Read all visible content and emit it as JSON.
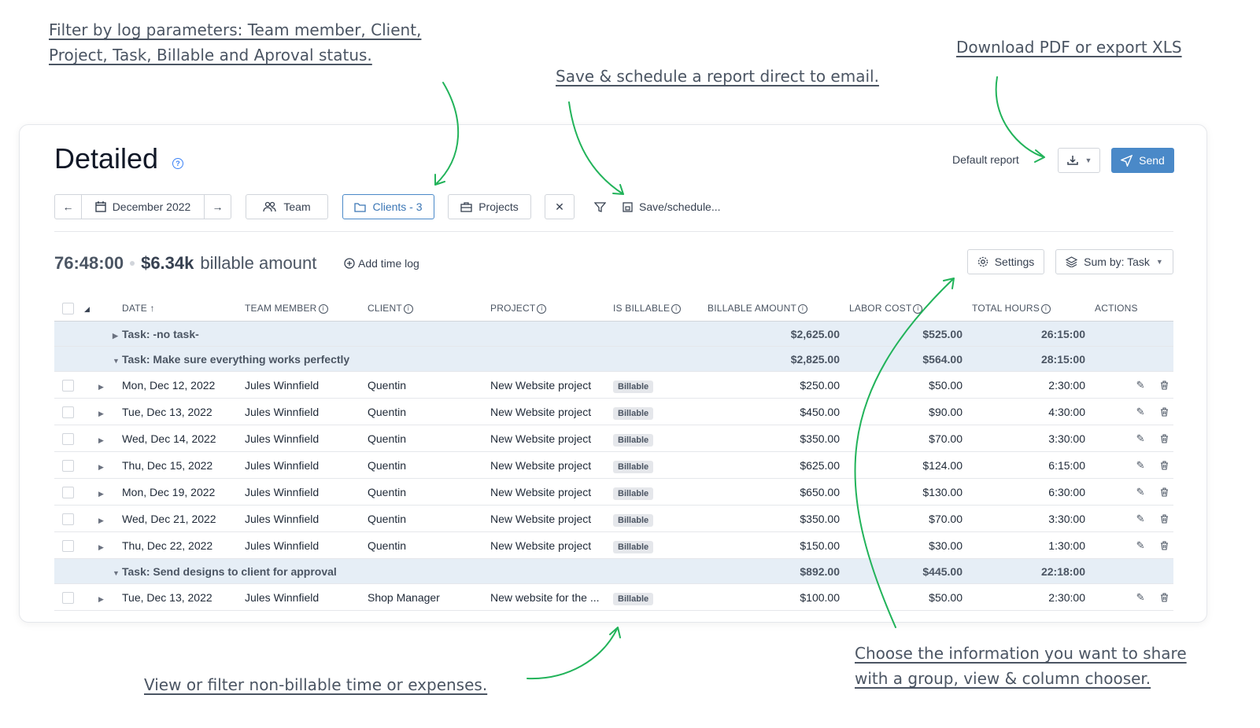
{
  "annotations": {
    "filter_line1": "Filter by log parameters: Team member, Client, ",
    "filter_line2": "Project, Task, Billable and Aproval status.",
    "save_schedule": "Save & schedule a report direct to email.",
    "download": "Download PDF or export XLS",
    "non_billable": "View or filter non-billable time or expenses.",
    "choose_line1": "Choose the information you want to share",
    "choose_line2": "with a group, view & column chooser."
  },
  "header": {
    "title": "Detailed",
    "default_report": "Default report",
    "send_label": "Send"
  },
  "filters": {
    "date_label": "December 2022",
    "team_label": "Team",
    "clients_label": "Clients - 3",
    "projects_label": "Projects",
    "clear_label": "✕",
    "save_label": "Save/schedule..."
  },
  "summary": {
    "hours": "76:48:00",
    "amount": "$6.34k",
    "amount_suffix": "billable amount",
    "add_log": "Add time log",
    "settings_label": "Settings",
    "sum_by_label": "Sum by: Task"
  },
  "table": {
    "columns": {
      "date": "DATE",
      "team_member": "TEAM MEMBER",
      "client": "CLIENT",
      "project": "PROJECT",
      "is_billable": "IS BILLABLE",
      "billable_amount": "BILLABLE AMOUNT",
      "labor_cost": "LABOR COST",
      "total_hours": "TOTAL HOURS",
      "actions": "ACTIONS"
    },
    "groups": [
      {
        "label": "Task: -no task-",
        "billable": "$2,625.00",
        "cost": "$525.00",
        "hours": "26:15:00"
      },
      {
        "label": "Task: Make sure everything works perfectly",
        "billable": "$2,825.00",
        "cost": "$564.00",
        "hours": "28:15:00"
      },
      {
        "label": "Task: Send designs to client for approval",
        "billable": "$892.00",
        "cost": "$445.00",
        "hours": "22:18:00"
      }
    ],
    "rows": [
      {
        "date": "Mon, Dec 12, 2022",
        "member": "Jules Winnfield",
        "client": "Quentin",
        "project": "New Website project",
        "billable": "Billable",
        "amount": "$250.00",
        "cost": "$50.00",
        "hours": "2:30:00"
      },
      {
        "date": "Tue, Dec 13, 2022",
        "member": "Jules Winnfield",
        "client": "Quentin",
        "project": "New Website project",
        "billable": "Billable",
        "amount": "$450.00",
        "cost": "$90.00",
        "hours": "4:30:00"
      },
      {
        "date": "Wed, Dec 14, 2022",
        "member": "Jules Winnfield",
        "client": "Quentin",
        "project": "New Website project",
        "billable": "Billable",
        "amount": "$350.00",
        "cost": "$70.00",
        "hours": "3:30:00"
      },
      {
        "date": "Thu, Dec 15, 2022",
        "member": "Jules Winnfield",
        "client": "Quentin",
        "project": "New Website project",
        "billable": "Billable",
        "amount": "$625.00",
        "cost": "$124.00",
        "hours": "6:15:00"
      },
      {
        "date": "Mon, Dec 19, 2022",
        "member": "Jules Winnfield",
        "client": "Quentin",
        "project": "New Website project",
        "billable": "Billable",
        "amount": "$650.00",
        "cost": "$130.00",
        "hours": "6:30:00"
      },
      {
        "date": "Wed, Dec 21, 2022",
        "member": "Jules Winnfield",
        "client": "Quentin",
        "project": "New Website project",
        "billable": "Billable",
        "amount": "$350.00",
        "cost": "$70.00",
        "hours": "3:30:00"
      },
      {
        "date": "Thu, Dec 22, 2022",
        "member": "Jules Winnfield",
        "client": "Quentin",
        "project": "New Website project",
        "billable": "Billable",
        "amount": "$150.00",
        "cost": "$30.00",
        "hours": "1:30:00"
      },
      {
        "date": "Tue, Dec 13, 2022",
        "member": "Jules Winnfield",
        "client": "Shop Manager",
        "project": "New website for the ...",
        "billable": "Billable",
        "amount": "$100.00",
        "cost": "$50.00",
        "hours": "2:30:00"
      }
    ]
  },
  "colors": {
    "accent": "#4a89c8",
    "group_bg": "#e6eef6",
    "arrow": "#22b35a"
  }
}
